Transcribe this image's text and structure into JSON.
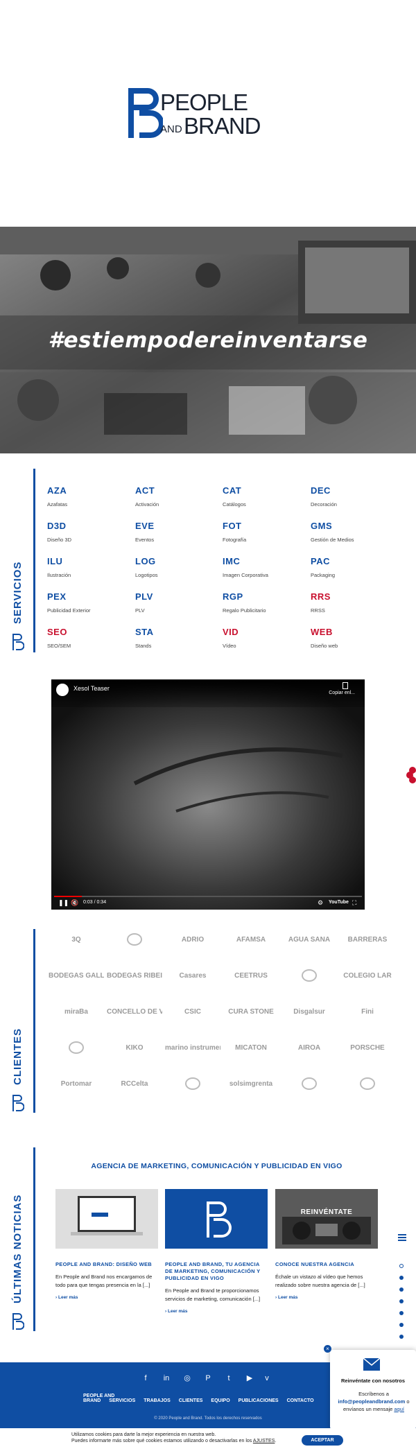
{
  "logo": {
    "line1": "PEOPLE",
    "and": "AND",
    "line2": "BRAND"
  },
  "hero": {
    "hashtag": "#estiempodereinventarse"
  },
  "services": {
    "label": "SERVICIOS",
    "items": [
      {
        "code": "AZA",
        "name": "Azafatas",
        "color": "#0f4ea3"
      },
      {
        "code": "ACT",
        "name": "Activación",
        "color": "#0f4ea3"
      },
      {
        "code": "CAT",
        "name": "Catálogos",
        "color": "#0f4ea3"
      },
      {
        "code": "DEC",
        "name": "Decoración",
        "color": "#0f4ea3"
      },
      {
        "code": "D3D",
        "name": "Diseño 3D",
        "color": "#0f4ea3"
      },
      {
        "code": "EVE",
        "name": "Eventos",
        "color": "#0f4ea3"
      },
      {
        "code": "FOT",
        "name": "Fotografía",
        "color": "#0f4ea3"
      },
      {
        "code": "GMS",
        "name": "Gestión de Medios",
        "color": "#0f4ea3"
      },
      {
        "code": "ILU",
        "name": "Ilustración",
        "color": "#0f4ea3"
      },
      {
        "code": "LOG",
        "name": "Logotipos",
        "color": "#0f4ea3"
      },
      {
        "code": "IMC",
        "name": "Imagen Corporativa",
        "color": "#0f4ea3"
      },
      {
        "code": "PAC",
        "name": "Packaging",
        "color": "#0f4ea3"
      },
      {
        "code": "PEX",
        "name": "Publicidad Exterior",
        "color": "#0f4ea3"
      },
      {
        "code": "PLV",
        "name": "PLV",
        "color": "#0f4ea3"
      },
      {
        "code": "RGP",
        "name": "Regalo Publicitario",
        "color": "#0f4ea3"
      },
      {
        "code": "RRS",
        "name": "RRSS",
        "color": "#c8102e"
      },
      {
        "code": "SEO",
        "name": "SEO/SEM",
        "color": "#c8102e"
      },
      {
        "code": "STA",
        "name": "Stands",
        "color": "#0f4ea3"
      },
      {
        "code": "VID",
        "name": "Vídeo",
        "color": "#c8102e"
      },
      {
        "code": "WEB",
        "name": "Diseño web",
        "color": "#c8102e"
      }
    ]
  },
  "video": {
    "title": "Xesol Teaser",
    "copy_label": "Copiar enl...",
    "time": "0:03 / 0:34",
    "progress": 0.09,
    "brand": "YouTube"
  },
  "clients": {
    "label": "CLIENTES",
    "logos": [
      "3Q",
      "",
      "ADRIO",
      "AFAMSA",
      "AGUA SANA",
      "BARRERAS",
      "BODEGAS GALLEGAS",
      "BODEGAS RIBEIRO",
      "Casares",
      "CEETRUS",
      "",
      "COLEGIO LAR",
      "miraBa",
      "CONCELLO DE VIGO",
      "CSIC",
      "CURA STONE",
      "Disgalsur",
      "Fini",
      "",
      "KIKO",
      "marino instruments",
      "MICATON",
      "AIROA",
      "PORSCHE",
      "Portomar",
      "RCCelta",
      "",
      "solsimgrenta",
      "",
      ""
    ]
  },
  "news": {
    "label": "ÚLTIMAS NOTICIAS",
    "heading": "AGENCIA DE MARKETING, COMUNICACIÓN Y PUBLICIDAD EN VIGO",
    "cards": [
      {
        "title": "PEOPLE AND BRAND: DISEÑO WEB",
        "text": "En People and Brand nos encargamos de todo para que tengas presencia en la [...]",
        "more": "Leer más"
      },
      {
        "title": "PEOPLE AND BRAND, TU AGENCIA DE MARKETING, COMUNICACIÓN Y PUBLICIDAD EN VIGO",
        "text": "En People and Brand te proporcionamos servicios de marketing, comunicación [...]",
        "more": "Leer más"
      },
      {
        "title": "CONOCE NUESTRA AGENCIA",
        "text": "Échale un vistazo al vídeo que hemos realizado sobre nuestra agencia de [...]",
        "more": "Leer más",
        "image_text": "REINVÉNTATE"
      }
    ]
  },
  "footer": {
    "social": [
      "f",
      "in",
      "◎",
      "P",
      "t",
      "▶",
      "v",
      "▣"
    ],
    "nav": [
      "PEOPLE AND BRAND",
      "SERVICIOS",
      "TRABAJOS",
      "CLIENTES",
      "EQUIPO",
      "PUBLICACIONES",
      "CONTACTO"
    ],
    "copyright": "© 2020 People and Brand. Todos los derechos reservados"
  },
  "chat": {
    "close": "×",
    "title": "Reinvéntate con nosotros",
    "line1": "Escríbenos a",
    "email": "info@peopleandbrand.com",
    "line2": "o envíanos un mensaje",
    "link": "aquí"
  },
  "cookie": {
    "line1": "Utilizamos cookies para darte la mejor experiencia en nuestra web.",
    "line2": "Puedes informarte más sobre qué cookies estamos utilizando o desactivarlas en los",
    "link": "AJUSTES",
    "button": "ACEPTAR"
  },
  "colors": {
    "brand": "#0f4ea3",
    "accent_red": "#c8102e"
  }
}
